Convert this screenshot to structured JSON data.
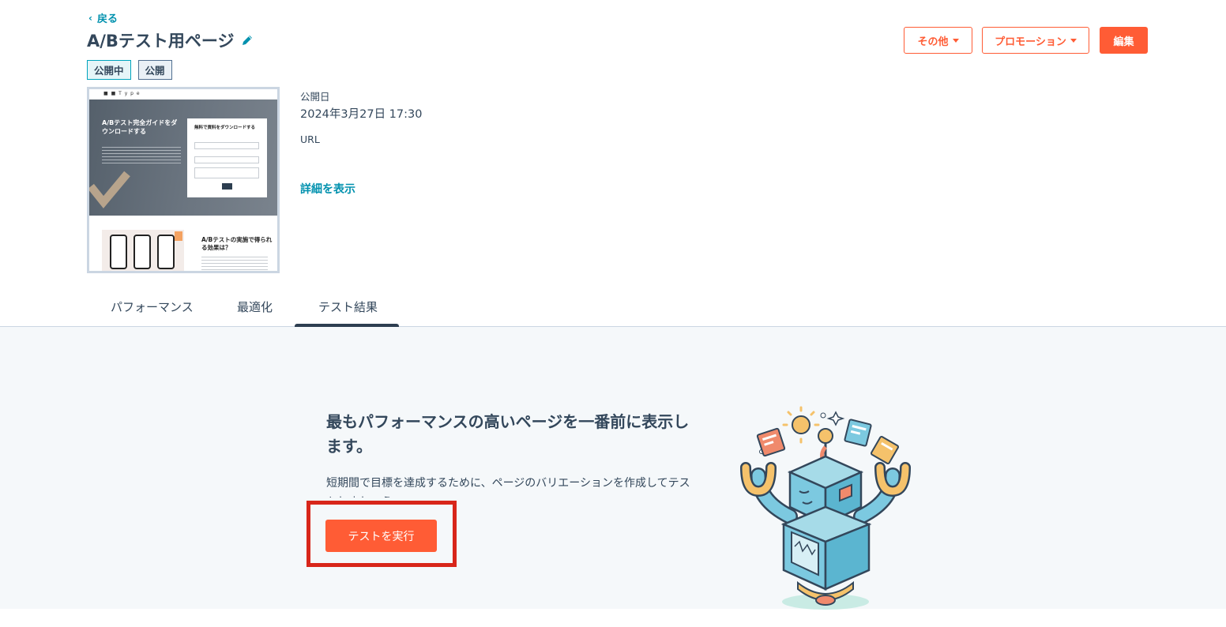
{
  "header": {
    "back_label": "戻る",
    "page_title": "A/Bテスト用ページ",
    "badges": [
      "公開中",
      "公開"
    ],
    "buttons": {
      "other": "その他",
      "promotion": "プロモーション",
      "edit": "編集"
    }
  },
  "thumbnail": {
    "logo_text": "■ ■ T y p e",
    "hero_title": "A/Bテスト完全ガイドをダウンロードする",
    "form_title": "無料で資料をダウンロードする",
    "bottom_title": "A/Bテストの実施で得られる効果は？"
  },
  "meta": {
    "published_label": "公開日",
    "published_date": "2024年3月27日 17:30",
    "url_label": "URL",
    "detail_link": "詳細を表示"
  },
  "tabs": [
    {
      "label": "パフォーマンス",
      "active": false
    },
    {
      "label": "最適化",
      "active": false
    },
    {
      "label": "テスト結果",
      "active": true
    }
  ],
  "empty_state": {
    "title": "最もパフォーマンスの高いページを一番前に表示します。",
    "description": "短期間で目標を達成するために、ページのバリエーションを作成してテストしましょう。",
    "run_button": "テストを実行"
  },
  "colors": {
    "accent": "#ff5c35",
    "link": "#0091ae",
    "highlight": "#d8261a",
    "text": "#33475b",
    "panel_bg": "#f5f8fa"
  }
}
